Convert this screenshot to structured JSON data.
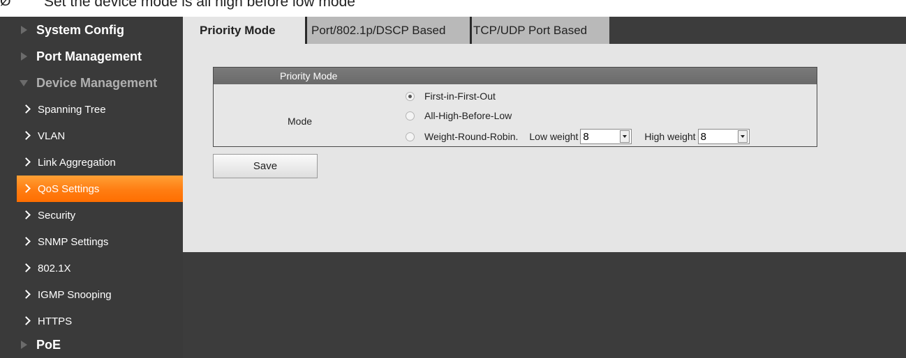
{
  "caption": {
    "bullet": "Ø",
    "text": "Set the device mode is all high before low mode"
  },
  "sidebar": {
    "items": [
      {
        "label": "System Config"
      },
      {
        "label": "Port Management"
      },
      {
        "label": "Device Management"
      },
      {
        "label": "Spanning Tree"
      },
      {
        "label": "VLAN"
      },
      {
        "label": "Link Aggregation"
      },
      {
        "label": "QoS Settings"
      },
      {
        "label": "Security"
      },
      {
        "label": "SNMP Settings"
      },
      {
        "label": "802.1X"
      },
      {
        "label": "IGMP Snooping"
      },
      {
        "label": "HTTPS"
      },
      {
        "label": "PoE"
      }
    ]
  },
  "tabs": [
    {
      "label": "Priority Mode"
    },
    {
      "label": "Port/802.1p/DSCP Based"
    },
    {
      "label": "TCP/UDP Port Based"
    }
  ],
  "panel": {
    "title": "Priority Mode",
    "mode_label": "Mode",
    "options": [
      {
        "label": "First-in-First-Out",
        "checked": true
      },
      {
        "label": "All-High-Before-Low",
        "checked": false
      },
      {
        "label": "Weight-Round-Robin.",
        "checked": false
      }
    ],
    "low_weight_label": "Low weight",
    "low_weight_value": "8",
    "high_weight_label": "High weight",
    "high_weight_value": "8"
  },
  "save_label": "Save",
  "colors": {
    "accent": "#ff7d12",
    "sidebar_bg": "#3a3a3a",
    "content_bg": "#e5e5e5",
    "panel_header": "#707070"
  }
}
